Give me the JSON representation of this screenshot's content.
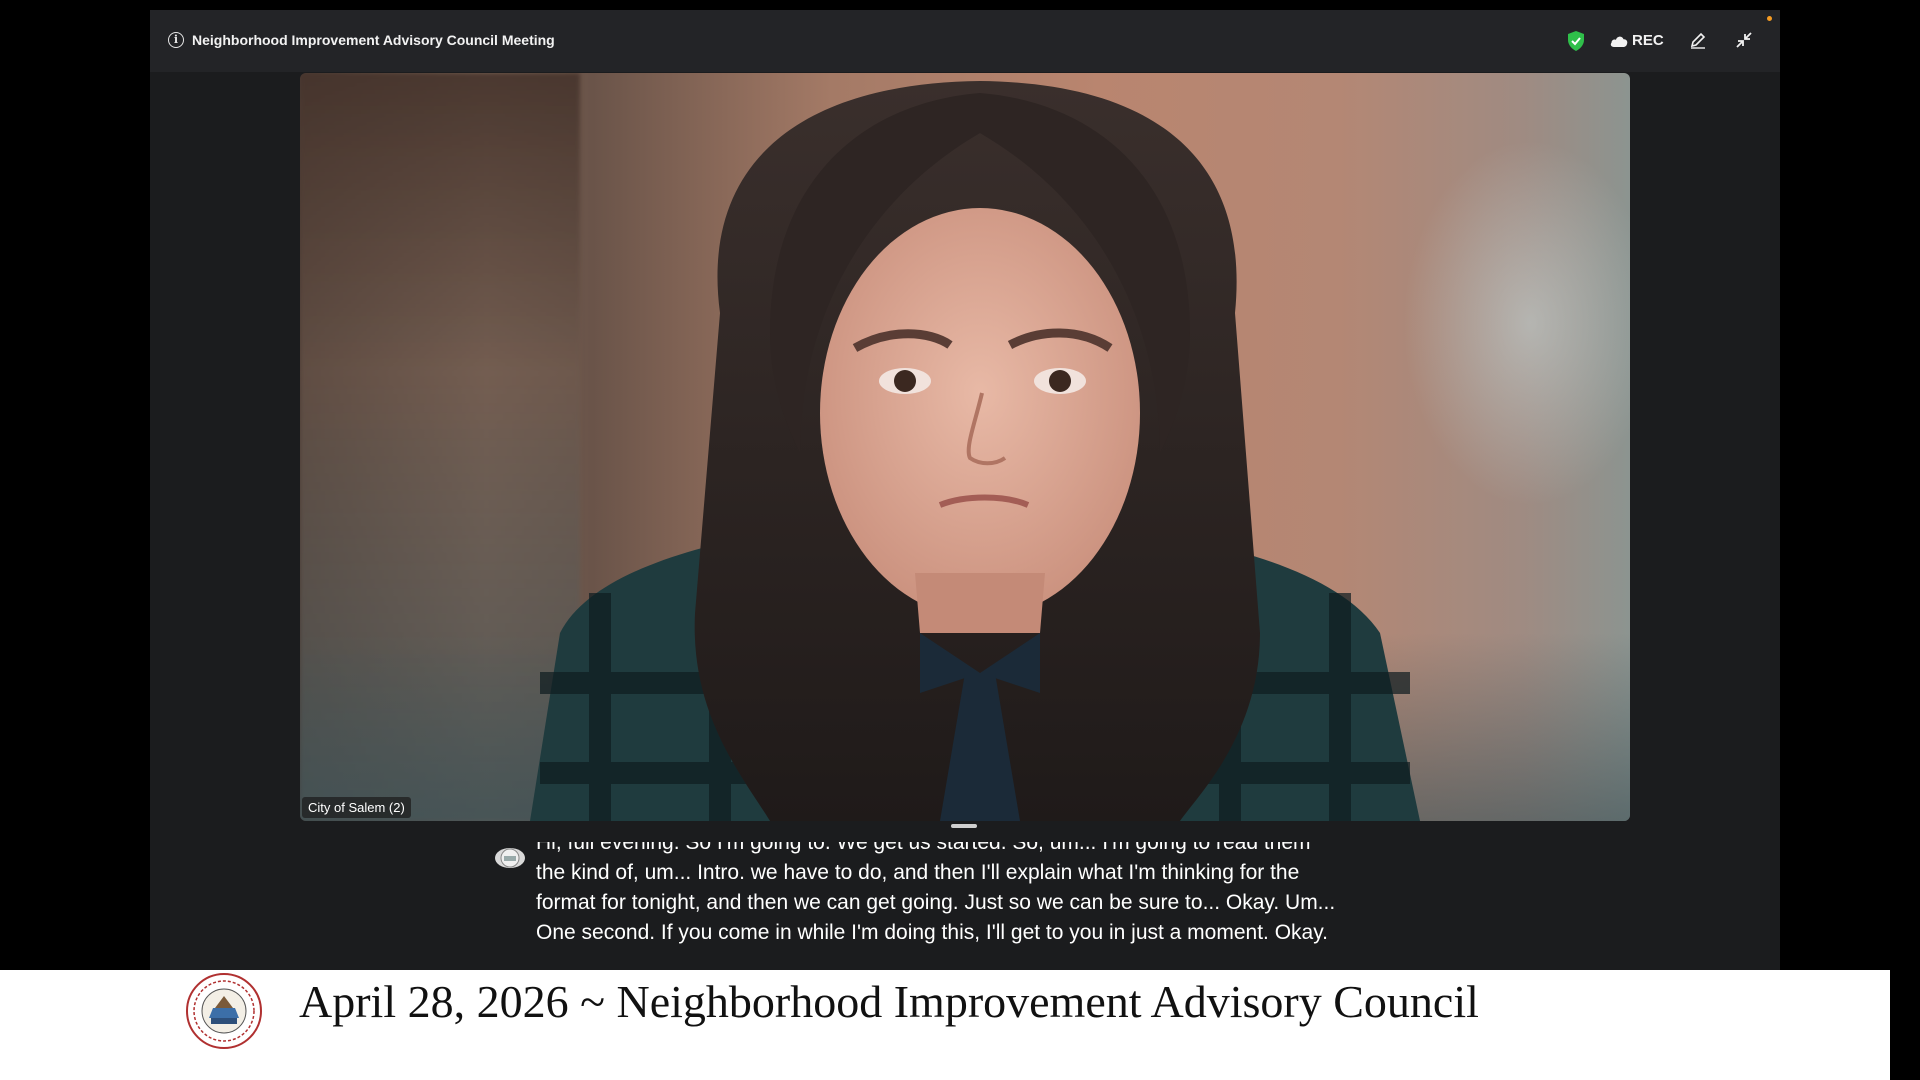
{
  "window": {
    "title": "Neighborhood Improvement Advisory Council Meeting",
    "recording_label": "REC",
    "colors": {
      "titlebar": "#232427",
      "shield": "#2fbf4a",
      "indicator": "#f59b22"
    },
    "icons": [
      "info-icon",
      "shield-icon",
      "cloud-icon",
      "pencil-icon",
      "minimize-icon"
    ]
  },
  "video": {
    "participant_name": "City of Salem (2)"
  },
  "captions": {
    "lines": [
      "Hi, full evening. So I'm going to. We get us started. So, um... I'm going to read them",
      "the kind of, um... Intro. we have to do, and then I'll explain what I'm thinking for the",
      "format for tonight, and then we can get going. Just so we can be sure to... Okay. Um...",
      "One second. If you come in while I'm doing this, I'll get to you in just a moment. Okay."
    ]
  },
  "banner": {
    "text": "April 28, 2026 ~ Neighborhood Improvement Advisory Council",
    "seal_icon": "city-seal-icon"
  }
}
